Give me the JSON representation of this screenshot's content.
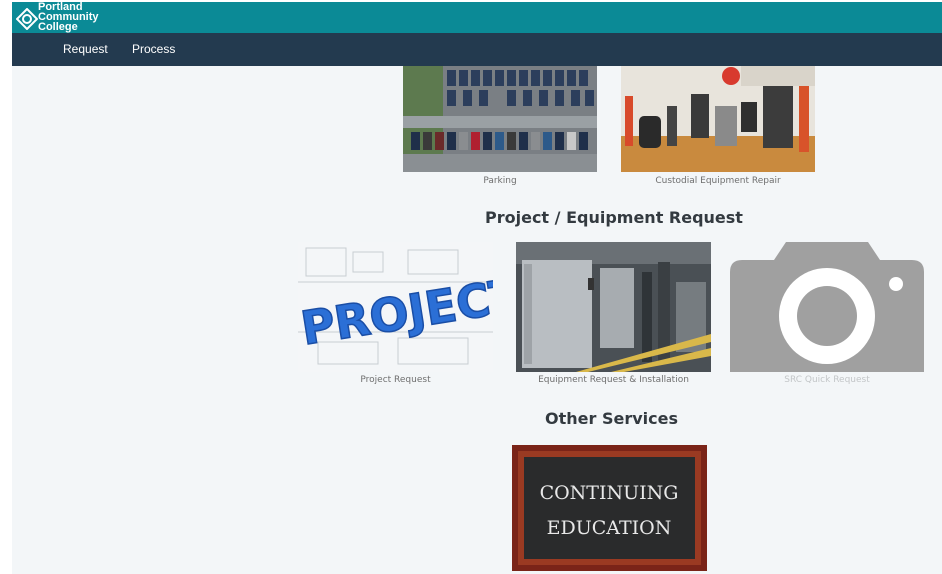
{
  "header": {
    "logo_lines": [
      "Portland",
      "Community",
      "College"
    ]
  },
  "nav": {
    "items": [
      {
        "label": "Request"
      },
      {
        "label": "Process"
      }
    ]
  },
  "tiles_top": [
    {
      "caption": "Parking"
    },
    {
      "caption": "Custodial Equipment Repair"
    }
  ],
  "sections": {
    "project": {
      "title": "Project / Equipment Request",
      "tiles": [
        {
          "caption": "Project Request",
          "image_text": "PROJECT"
        },
        {
          "caption": "Equipment Request & Installation"
        },
        {
          "caption": "SRC Quick Request",
          "disabled": true
        }
      ]
    },
    "other": {
      "title": "Other Services",
      "tiles": [
        {
          "image_text_line1": "CONTINUING",
          "image_text_line2": "EDUCATION"
        }
      ]
    }
  },
  "colors": {
    "topbar": "#0b8a96",
    "navbar": "#233a4f",
    "background": "#f3f6f8"
  },
  "icons": {
    "camera": "camera-icon",
    "logo": "pcc-logo-icon"
  }
}
